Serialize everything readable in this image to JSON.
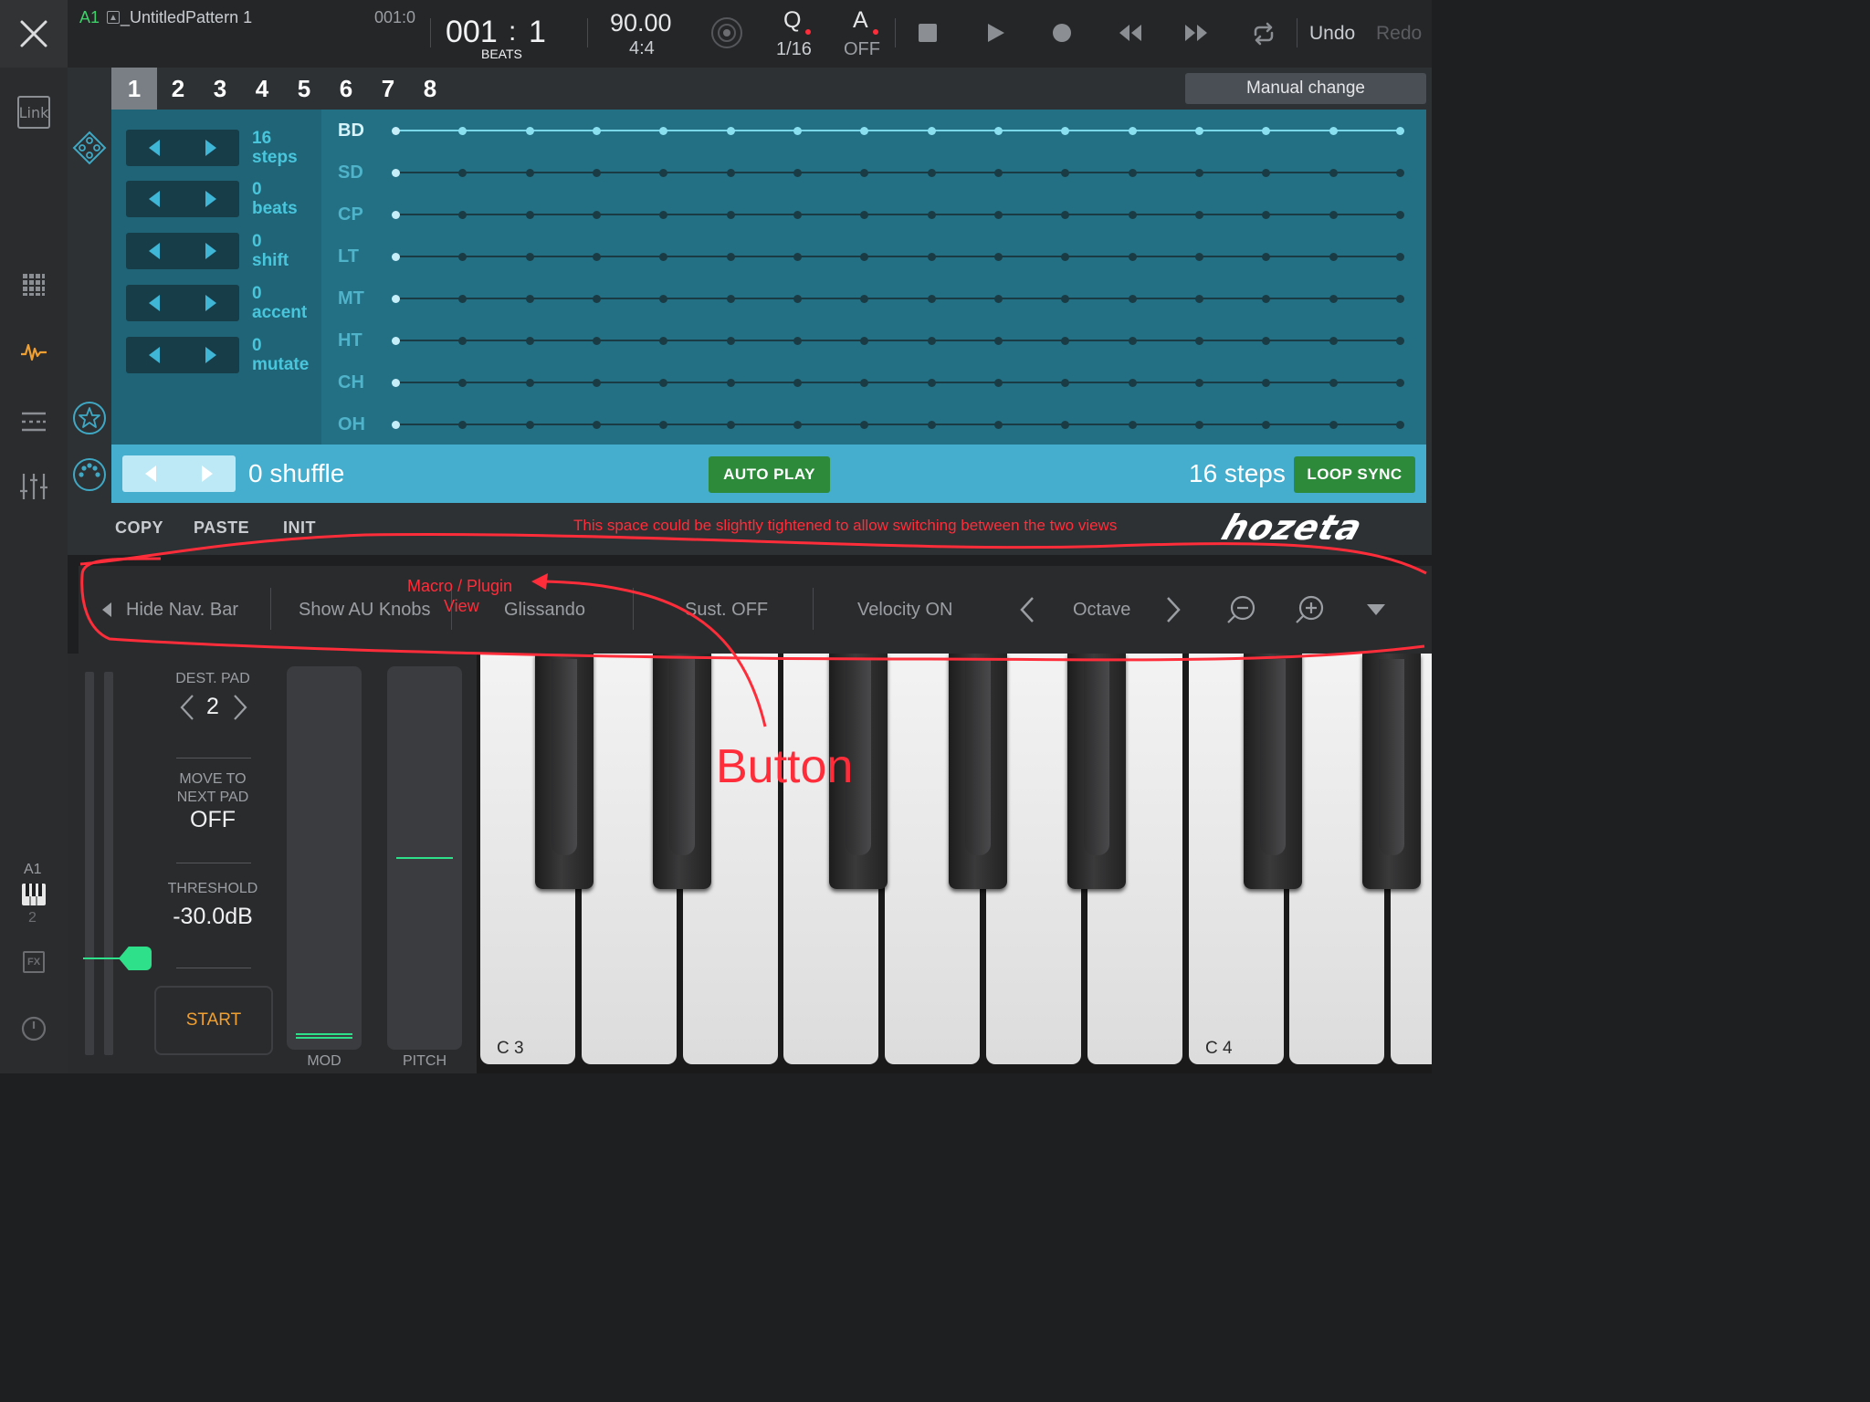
{
  "topbar": {
    "track_id": "A1",
    "pattern_name": "_UntitledPattern 1",
    "position_small": "001:0",
    "bar": "001",
    "colon": ":",
    "beat": "1",
    "beats_label": "BEATS",
    "tempo": "90.00",
    "signature": "4:4",
    "quantize_label": "Q",
    "quantize_value": "1/16",
    "auto_label": "A",
    "auto_value": "OFF",
    "undo": "Undo",
    "redo": "Redo"
  },
  "sidebar": {
    "link_label": "Link",
    "track_id": "A1",
    "track_number": "2",
    "fx_label": "FX"
  },
  "pattern_tabs": [
    "1",
    "2",
    "3",
    "4",
    "5",
    "6",
    "7",
    "8"
  ],
  "manual_change": "Manual change",
  "controls": [
    {
      "value": "16",
      "name": "steps"
    },
    {
      "value": "0",
      "name": "beats"
    },
    {
      "value": "0",
      "name": "shift"
    },
    {
      "value": "0",
      "name": "accent"
    },
    {
      "value": "0",
      "name": "mutate"
    }
  ],
  "drum_rows": [
    "BD",
    "SD",
    "CP",
    "LT",
    "MT",
    "HT",
    "CH",
    "OH"
  ],
  "grid": {
    "steps": 16,
    "active_row": 0
  },
  "bottom": {
    "shuffle": "0 shuffle",
    "auto_play": "AUTO PLAY",
    "steps": "16 steps",
    "loop_sync": "LOOP SYNC"
  },
  "actions": {
    "copy": "COPY",
    "paste": "PASTE",
    "init": "INIT"
  },
  "brand": "hozeta",
  "keyboard_nav": {
    "hide_nav": "Hide Nav. Bar",
    "show_au": "Show AU Knobs",
    "glissando": "Glissando",
    "sustain": "Sust. OFF",
    "velocity": "Velocity ON",
    "octave": "Octave"
  },
  "pad_controls": {
    "dest_pad_label": "DEST. PAD",
    "dest_pad_value": "2",
    "move_label_1": "MOVE TO",
    "move_label_2": "NEXT PAD",
    "move_value": "OFF",
    "threshold_label": "THRESHOLD",
    "threshold_value": "-30.0dB",
    "start": "START",
    "mod": "MOD",
    "pitch": "PITCH"
  },
  "key_labels": {
    "c3": "C 3",
    "c4": "C 4"
  },
  "annotations": {
    "note_top": "This space could be slightly tightened to allow switching between the two views",
    "macro_1": "Macro / Plugin",
    "macro_2": "View",
    "button": "Button"
  },
  "colors": {
    "accent_teal": "#237085",
    "accent_light_blue": "#45adcd",
    "green_button": "#2c8a3a",
    "annotation_red": "#ff2d3a",
    "start_orange": "#f0a030"
  }
}
